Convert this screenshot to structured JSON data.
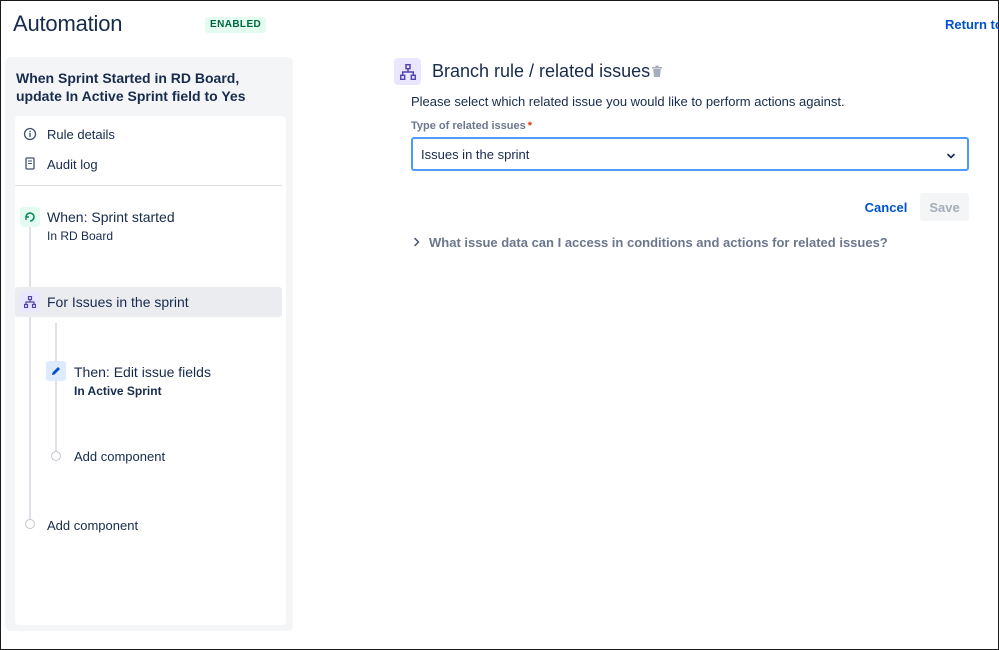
{
  "header": {
    "title": "Automation",
    "status": "ENABLED",
    "return_link": "Return to"
  },
  "sidebar": {
    "rule_name": "When Sprint Started in RD Board, update In Active Sprint field to Yes",
    "links": [
      {
        "label": "Rule details",
        "icon": "info-icon"
      },
      {
        "label": "Audit log",
        "icon": "document-icon"
      }
    ],
    "trigger": {
      "title": "When: Sprint started",
      "subtitle": "In RD Board"
    },
    "branch": {
      "title": "For Issues in the sprint"
    },
    "action": {
      "title": "Then: Edit issue fields",
      "subtitle": "In Active Sprint"
    },
    "add_component_inner": "Add component",
    "add_component_outer": "Add component"
  },
  "panel": {
    "title": "Branch rule / related issues",
    "description": "Please select which related issue you would like to perform actions against.",
    "field_label": "Type of related issues",
    "required_mark": "*",
    "select_value": "Issues in the sprint",
    "cancel_label": "Cancel",
    "save_label": "Save",
    "faq": "What issue data can I access in conditions and actions for related issues?"
  },
  "colors": {
    "accent": "#0052cc",
    "enabled_bg": "#e3fcef",
    "enabled_text": "#006644",
    "focus_border": "#4c9aff"
  }
}
